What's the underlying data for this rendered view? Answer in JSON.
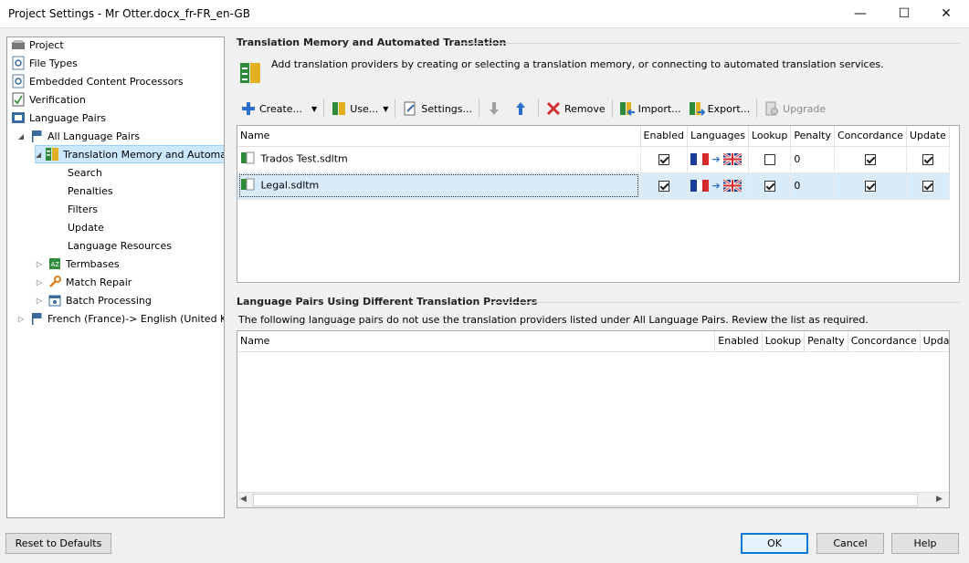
{
  "window": {
    "title": "Project Settings - Mr Otter.docx_fr-FR_en-GB",
    "minimize": "—",
    "maximize": "☐",
    "close": "✕"
  },
  "tree": [
    {
      "label": "Project",
      "icon": "project-icon",
      "expander": ""
    },
    {
      "label": "File Types",
      "icon": "settings-doc-icon",
      "expander": ""
    },
    {
      "label": "Embedded Content Processors",
      "icon": "settings-doc-icon",
      "expander": ""
    },
    {
      "label": "Verification",
      "icon": "verification-icon",
      "expander": ""
    },
    {
      "label": "Language Pairs",
      "icon": "language-pairs-icon",
      "expander": ""
    },
    {
      "label": "All Language Pairs",
      "icon": "flag-icon",
      "expander": "◢"
    },
    {
      "label": "Translation Memory and Automat",
      "icon": "tm-icon",
      "expander": "◢"
    },
    {
      "label": "Search",
      "icon": "",
      "expander": ""
    },
    {
      "label": "Penalties",
      "icon": "",
      "expander": ""
    },
    {
      "label": "Filters",
      "icon": "",
      "expander": ""
    },
    {
      "label": "Update",
      "icon": "",
      "expander": ""
    },
    {
      "label": "Language Resources",
      "icon": "",
      "expander": ""
    },
    {
      "label": "Termbases",
      "icon": "termbase-icon",
      "expander": "▷"
    },
    {
      "label": "Match Repair",
      "icon": "wrench-icon",
      "expander": "▷"
    },
    {
      "label": "Batch Processing",
      "icon": "batch-icon",
      "expander": "▷"
    },
    {
      "label": "French (France)-> English (United Kin",
      "icon": "flag-icon",
      "expander": "▷"
    }
  ],
  "tm_section": {
    "title": "Translation Memory and Automated Translation",
    "description": "Add translation providers by creating or selecting a translation memory, or connecting to automated translation services."
  },
  "toolbar": {
    "create": "Create...",
    "use": "Use...",
    "settings": "Settings...",
    "remove": "Remove",
    "import": "Import...",
    "export": "Export...",
    "upgrade": "Upgrade"
  },
  "tm_table": {
    "headers": [
      "Name",
      "Enabled",
      "Languages",
      "Lookup",
      "Penalty",
      "Concordance",
      "Update"
    ],
    "rows": [
      {
        "name": "Trados Test.sdltm",
        "enabled": true,
        "lookup": false,
        "penalty": "0",
        "concordance": true,
        "update": true
      },
      {
        "name": "Legal.sdltm",
        "enabled": true,
        "lookup": true,
        "penalty": "0",
        "concordance": true,
        "update": true
      }
    ]
  },
  "lp_section": {
    "title": "Language Pairs Using Different Translation Providers",
    "description": "The following language pairs do not use the translation providers listed under All Language Pairs. Review the list as required."
  },
  "lp_table": {
    "headers": [
      "Name",
      "Enabled",
      "Lookup",
      "Penalty",
      "Concordance",
      "Upda"
    ]
  },
  "footer": {
    "reset": "Reset to Defaults",
    "ok": "OK",
    "cancel": "Cancel",
    "help": "Help"
  },
  "colors": {
    "accent": "#0078d7",
    "selection": "#cce8ff"
  }
}
